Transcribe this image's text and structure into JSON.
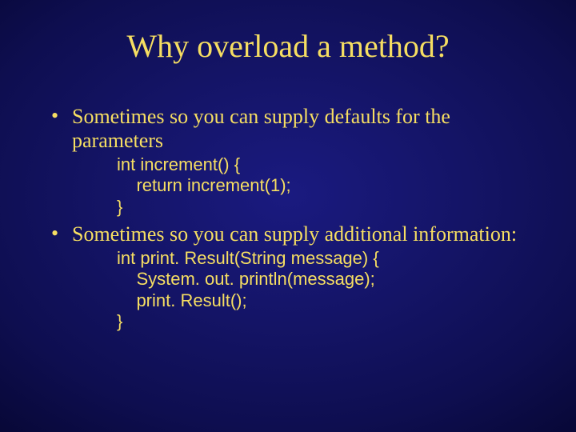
{
  "title": "Why overload a method?",
  "bullets": [
    {
      "text": "Sometimes so you can supply defaults for the parameters",
      "code": "int increment() {\n    return increment(1);\n}"
    },
    {
      "text": "Sometimes so you can supply additional information:",
      "code": "int print. Result(String message) {\n    System. out. println(message);\n    print. Result();\n}"
    }
  ]
}
